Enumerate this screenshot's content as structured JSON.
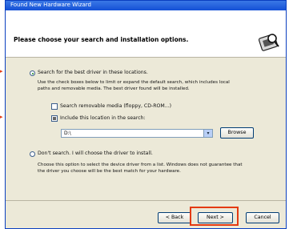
{
  "window": {
    "title": "Found New Hardware Wizard"
  },
  "header": {
    "heading": "Please choose your search and installation options."
  },
  "icons": {
    "header_icon": "hardware-search-icon"
  },
  "search_option": {
    "radio_label": "Search for the best driver in these locations.",
    "description_line1": "Use the check boxes below to limit or expand the default search, which includes local",
    "description_line2": "paths and removable media. The best driver found will be installed.",
    "removable_media_label": "Search removable media (floppy, CD-ROM...)",
    "include_location_label": "Include this location in the search:",
    "location_value": "D:\\",
    "browse_label": "Browse"
  },
  "manual_option": {
    "radio_label": "Don't search. I will choose the driver to install.",
    "description_line1": "Choose this option to select the device driver from a list. Windows does not guarantee that",
    "description_line2": "the driver you choose will be the best match for your hardware."
  },
  "buttons": {
    "back": "< Back",
    "next": "Next >",
    "cancel": "Cancel"
  },
  "colors": {
    "highlight": "#e43a12",
    "title_bar": "#1450d6"
  }
}
